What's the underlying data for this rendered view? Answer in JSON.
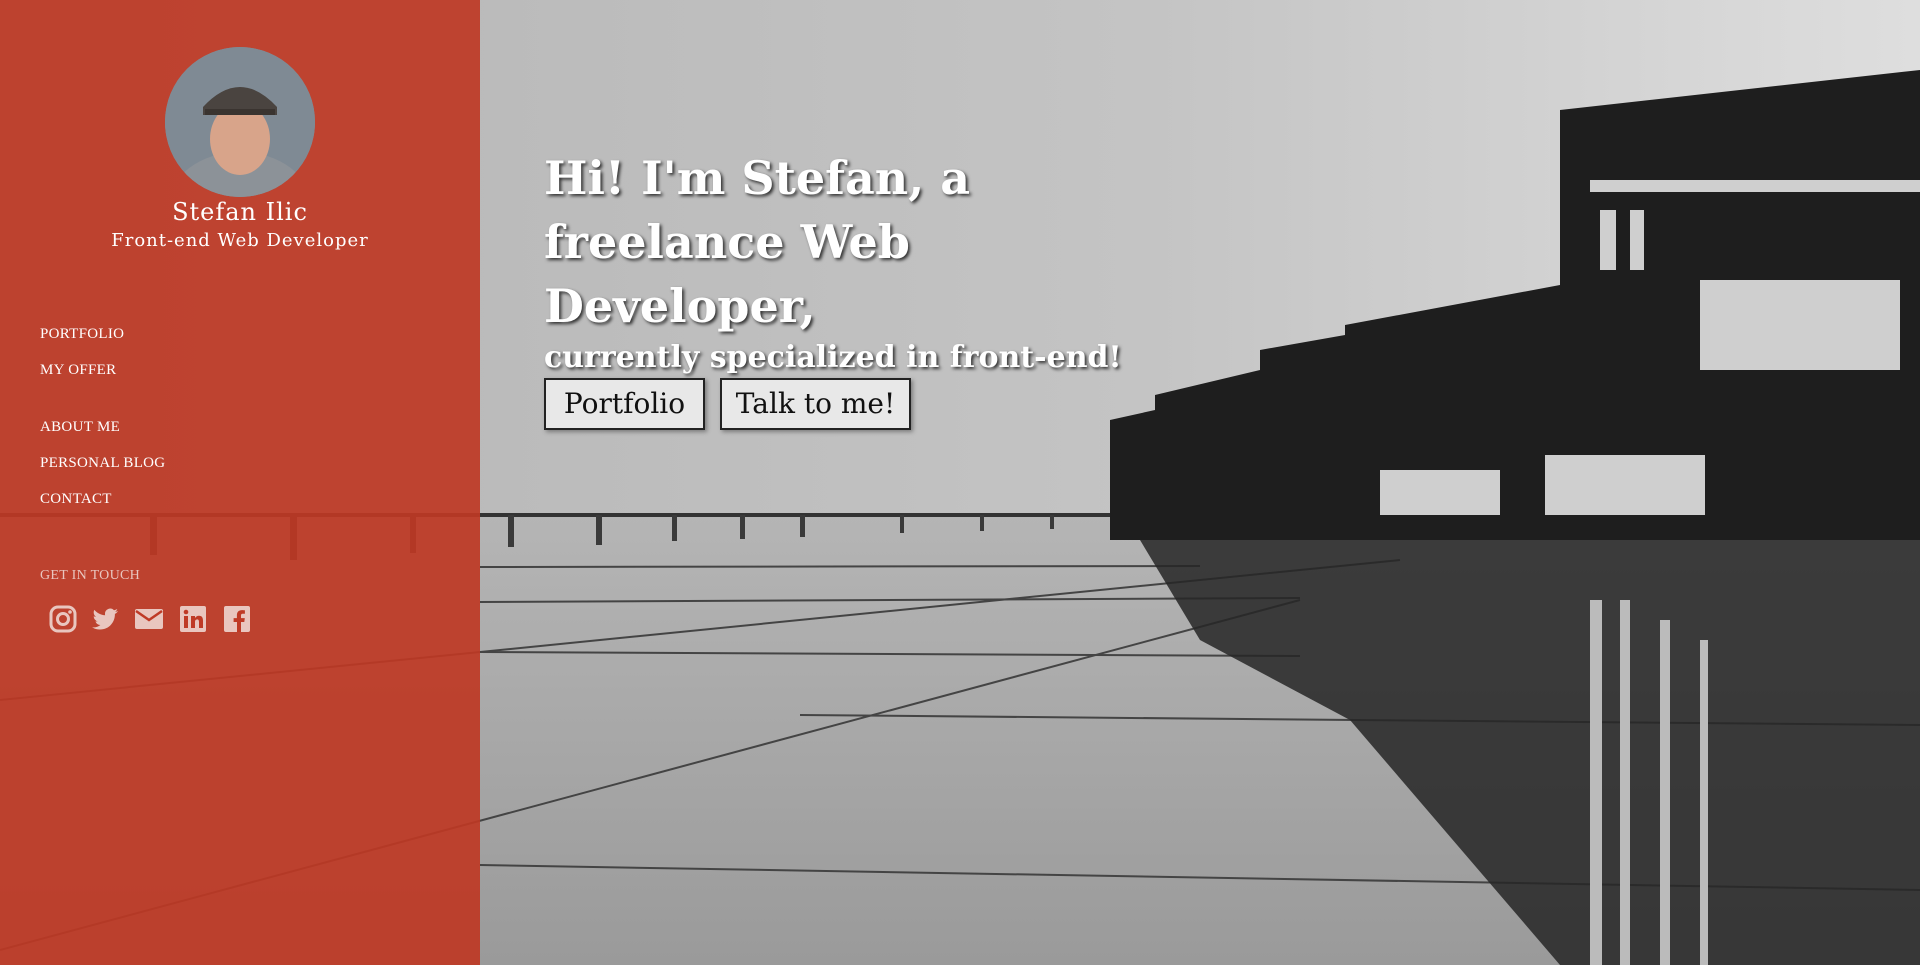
{
  "sidebar": {
    "name": "Stefan Ilic",
    "role": "Front-end Web Developer",
    "nav_primary": [
      {
        "label": "PORTFOLIO"
      },
      {
        "label": "MY OFFER"
      }
    ],
    "nav_secondary": [
      {
        "label": "ABOUT ME"
      },
      {
        "label": "PERSONAL BLOG"
      },
      {
        "label": "CONTACT"
      }
    ],
    "get_in_touch": "GET IN TOUCH",
    "social": [
      {
        "icon": "instagram-icon"
      },
      {
        "icon": "twitter-icon"
      },
      {
        "icon": "envelope-icon"
      },
      {
        "icon": "linkedin-icon"
      },
      {
        "icon": "facebook-icon"
      }
    ]
  },
  "hero": {
    "headline": "Hi! I'm Stefan, a freelance Web Developer,",
    "subheadline": "currently specialized in front-end!",
    "buttons": {
      "portfolio": "Portfolio",
      "talk": "Talk to me!"
    }
  },
  "colors": {
    "sidebar": "#be3824",
    "button_bg": "#e8e8e8",
    "text": "#ffffff"
  }
}
